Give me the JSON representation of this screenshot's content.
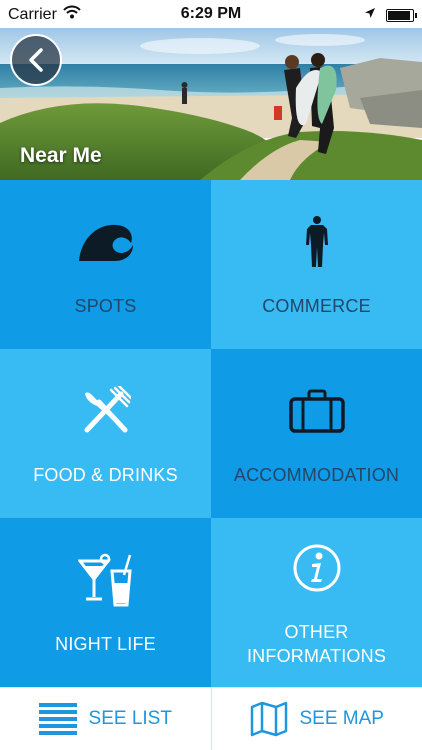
{
  "status_bar": {
    "carrier": "Carrier",
    "time": "6:29 PM"
  },
  "header": {
    "title": "Near Me"
  },
  "categories": [
    {
      "label": "SPOTS",
      "icon": "wave-icon"
    },
    {
      "label": "COMMERCE",
      "icon": "wetsuit-icon"
    },
    {
      "label": "FOOD & DRINKS",
      "icon": "fork-knife-icon"
    },
    {
      "label": "ACCOMMODATION",
      "icon": "suitcase-icon"
    },
    {
      "label": "NIGHT LIFE",
      "icon": "cocktail-icon"
    },
    {
      "label": "OTHER INFORMATIONS",
      "icon": "info-icon"
    }
  ],
  "bottom_bar": {
    "list_label": "SEE LIST",
    "map_label": "SEE MAP"
  },
  "colors": {
    "tile_dark": "#0f9be6",
    "tile_light": "#38baf2",
    "text_dark": "#24466a",
    "accent": "#1e97dc"
  }
}
